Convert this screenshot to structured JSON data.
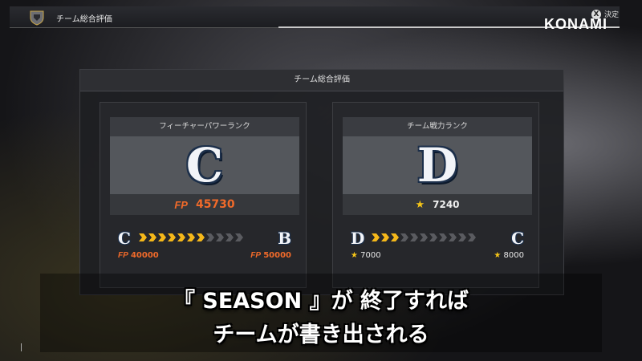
{
  "header": {
    "title": "チーム総合評価",
    "brand": "KONAMI",
    "confirm_button": "X",
    "confirm_label": "決定"
  },
  "modal": {
    "title": "チーム総合評価"
  },
  "feature_power": {
    "title": "フィーチャーパワーランク",
    "rank": "C",
    "fp_label": "FP",
    "value": "45730",
    "progress": {
      "from_rank": "C",
      "to_rank": "B",
      "filled_steps": 7,
      "total_steps": 11,
      "from_label": "FP",
      "from_value": "40000",
      "to_label": "FP",
      "to_value": "50000"
    }
  },
  "team_strength": {
    "title": "チーム戦力ランク",
    "rank": "D",
    "icon": "star-icon",
    "value": "7240",
    "progress": {
      "from_rank": "D",
      "to_rank": "C",
      "filled_steps": 3,
      "total_steps": 11,
      "from_value": "7000",
      "to_value": "8000"
    }
  },
  "subtitle": {
    "line1": "『 SEASON 』が 終了すれば",
    "line2": "チームが書き出される"
  },
  "colors": {
    "accent_orange": "#f06a2a",
    "star_yellow": "#f5c518",
    "chevron_on": "#f5b81a"
  }
}
